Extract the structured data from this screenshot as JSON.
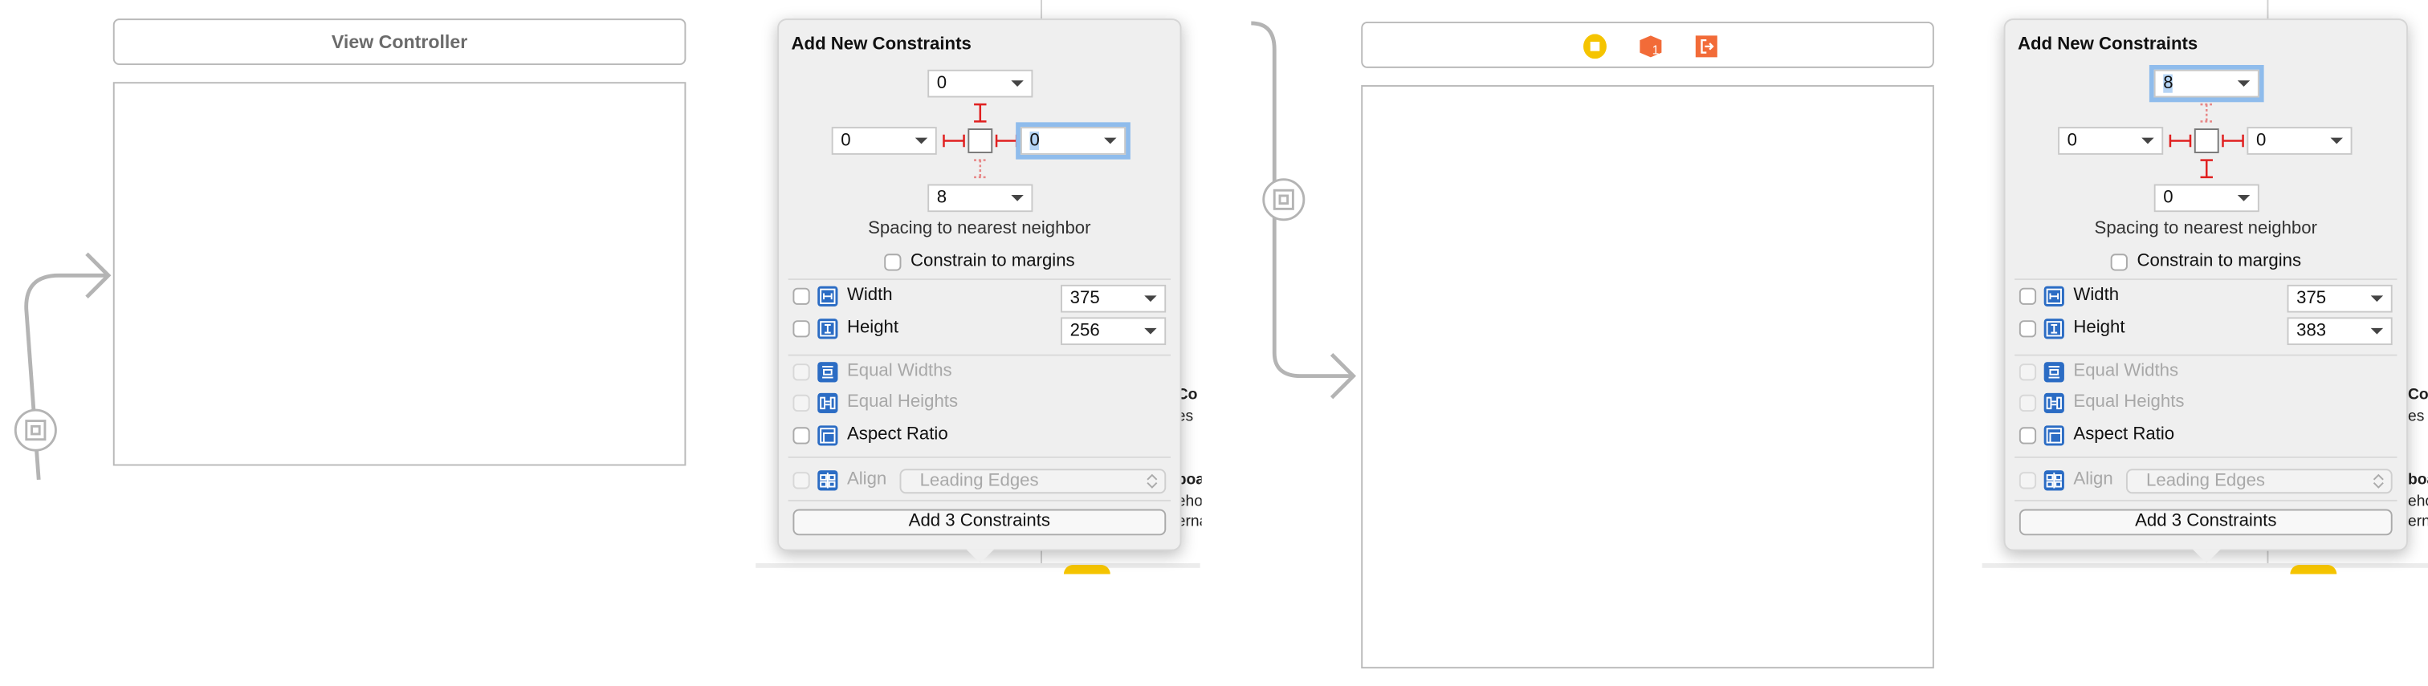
{
  "left_scene": {
    "title": "View Controller"
  },
  "right_scene": {
    "dock_icons": [
      "view-controller-icon",
      "first-responder-icon",
      "exit-icon"
    ]
  },
  "colors": {
    "accent": "#2b6cc4",
    "pin": "#e02020",
    "focus": "#8fbcec",
    "vc_yellow": "#f5c400",
    "orange": "#f26b38"
  },
  "side_text": [
    "Co",
    "es",
    "boa",
    "eho",
    "erna"
  ],
  "popovers": [
    {
      "title": "Add New Constraints",
      "spacing": {
        "top": "0",
        "left": "0",
        "right": "0",
        "bottom": "8"
      },
      "focused": "right",
      "pins": {
        "top": true,
        "left": true,
        "right": true,
        "bottom": false
      },
      "spacing_label": "Spacing to nearest neighbor",
      "constrain_margins": "Constrain to margins",
      "width_label": "Width",
      "width_value": "375",
      "height_label": "Height",
      "height_value": "256",
      "equal_widths": "Equal Widths",
      "equal_heights": "Equal Heights",
      "aspect_ratio": "Aspect Ratio",
      "align_label": "Align",
      "align_value": "Leading Edges",
      "add_button": "Add 3 Constraints"
    },
    {
      "title": "Add New Constraints",
      "spacing": {
        "top": "8",
        "left": "0",
        "right": "0",
        "bottom": "0"
      },
      "focused": "top",
      "pins": {
        "top": false,
        "left": true,
        "right": true,
        "bottom": true
      },
      "spacing_label": "Spacing to nearest neighbor",
      "constrain_margins": "Constrain to margins",
      "width_label": "Width",
      "width_value": "375",
      "height_label": "Height",
      "height_value": "383",
      "equal_widths": "Equal Widths",
      "equal_heights": "Equal Heights",
      "aspect_ratio": "Aspect Ratio",
      "align_label": "Align",
      "align_value": "Leading Edges",
      "add_button": "Add 3 Constraints"
    }
  ]
}
